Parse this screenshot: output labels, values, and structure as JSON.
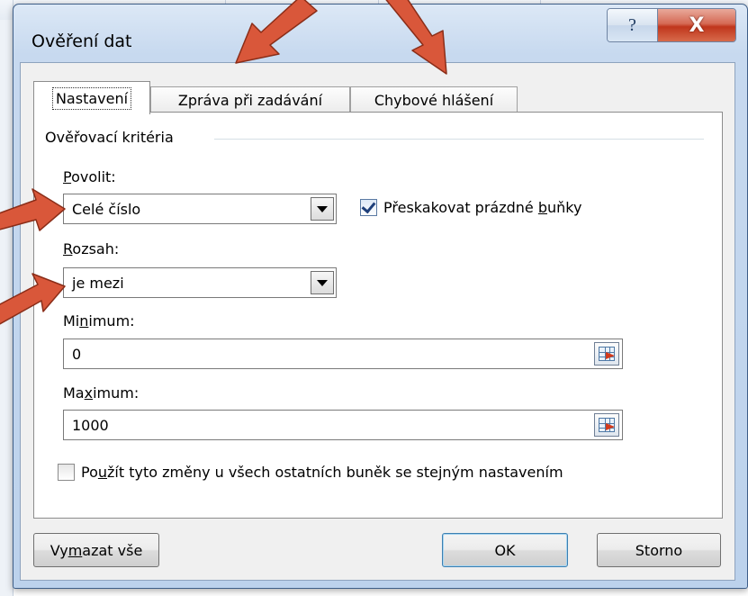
{
  "dialog": {
    "title": "Ověření dat",
    "help_glyph": "?",
    "close_glyph": "X"
  },
  "tabs": [
    {
      "label": "Nastavení",
      "active": true
    },
    {
      "label": "Zpráva při zadávání",
      "active": false
    },
    {
      "label": "Chybové hlášení",
      "active": false
    }
  ],
  "settings": {
    "group_label": "Ověřovací kritéria",
    "allow": {
      "label_pre": "",
      "label_key": "P",
      "label_post": "ovolit:",
      "value": "Celé číslo"
    },
    "ignore_blank": {
      "label_pre": "Přeskakovat prázdné ",
      "label_key": "b",
      "label_post": "uňky",
      "checked": true
    },
    "data": {
      "label_pre": "",
      "label_key": "R",
      "label_post": "ozsah:",
      "value": "je mezi"
    },
    "minimum": {
      "label_pre": "Mi",
      "label_key": "n",
      "label_post": "imum:",
      "value": "0"
    },
    "maximum": {
      "label_pre": "Ma",
      "label_key": "x",
      "label_post": "imum:",
      "value": "1000"
    },
    "apply_all": {
      "label_pre": "Po",
      "label_key": "u",
      "label_post": "žít tyto změny u všech ostatních buněk se stejným nastavením",
      "checked": false
    }
  },
  "buttons": {
    "clear_all": {
      "label_pre": "Vy",
      "label_key": "m",
      "label_post": "azat vše"
    },
    "ok": "OK",
    "cancel": "Storno"
  },
  "colors": {
    "annotation_arrow": "#d9573a",
    "title_bar": "#c7d9ef",
    "close_button": "#c0361c"
  }
}
